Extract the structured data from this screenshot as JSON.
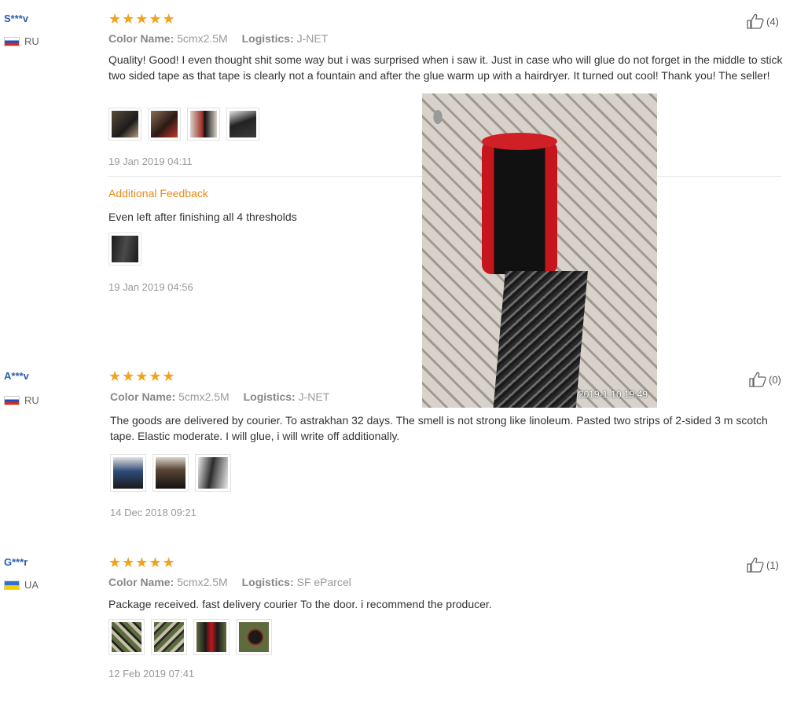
{
  "reviews": [
    {
      "user": "S***v",
      "country": "RU",
      "stars": "★★★★★",
      "color_label": "Color Name:",
      "color_value": "5cmx2.5M",
      "logistics_label": "Logistics:",
      "logistics_value": "J-NET",
      "text": "Quality! Good! I even thought shit some way but i was surprised when i saw it. Just in case who will glue do not forget in the middle to stick two sided tape as that tape is clearly not a fountain and after the glue warm up with a hairdryer. It turned out cool! Thank you! The seller!",
      "date": "19 Jan 2019 04:11",
      "likes": "(4)",
      "additional_feedback": {
        "title": "Additional Feedback",
        "text": "Even left after finishing all 4 thresholds",
        "date": "19 Jan 2019 04:56"
      }
    },
    {
      "user": "A***v",
      "country": "RU",
      "stars": "★★★★★",
      "color_label": "Color Name:",
      "color_value": "5cmx2.5M",
      "logistics_label": "Logistics:",
      "logistics_value": "J-NET",
      "text": "The goods are delivered by courier. To astrakhan 32 days. The smell is not strong like linoleum. Pasted two strips of 2-sided 3 m scotch tape. Elastic moderate. I will glue, i will write off additionally.",
      "date": "14 Dec 2018 09:21",
      "likes": "(0)"
    },
    {
      "user": "G***r",
      "country": "UA",
      "stars": "★★★★★",
      "color_label": "Color Name:",
      "color_value": "5cmx2.5M",
      "logistics_label": "Logistics:",
      "logistics_value": "SF eParcel",
      "text": "Package received. fast delivery courier To the door. i recommend the producer.",
      "date": "12 Feb 2019 07:41",
      "likes": "(1)"
    }
  ],
  "preview_photo": {
    "timestamp": "2019-1-10 19:49"
  },
  "icons": {
    "like": "thumbs-up-icon",
    "flag_ru": "flag-ru-icon",
    "flag_ua": "flag-ua-icon"
  }
}
